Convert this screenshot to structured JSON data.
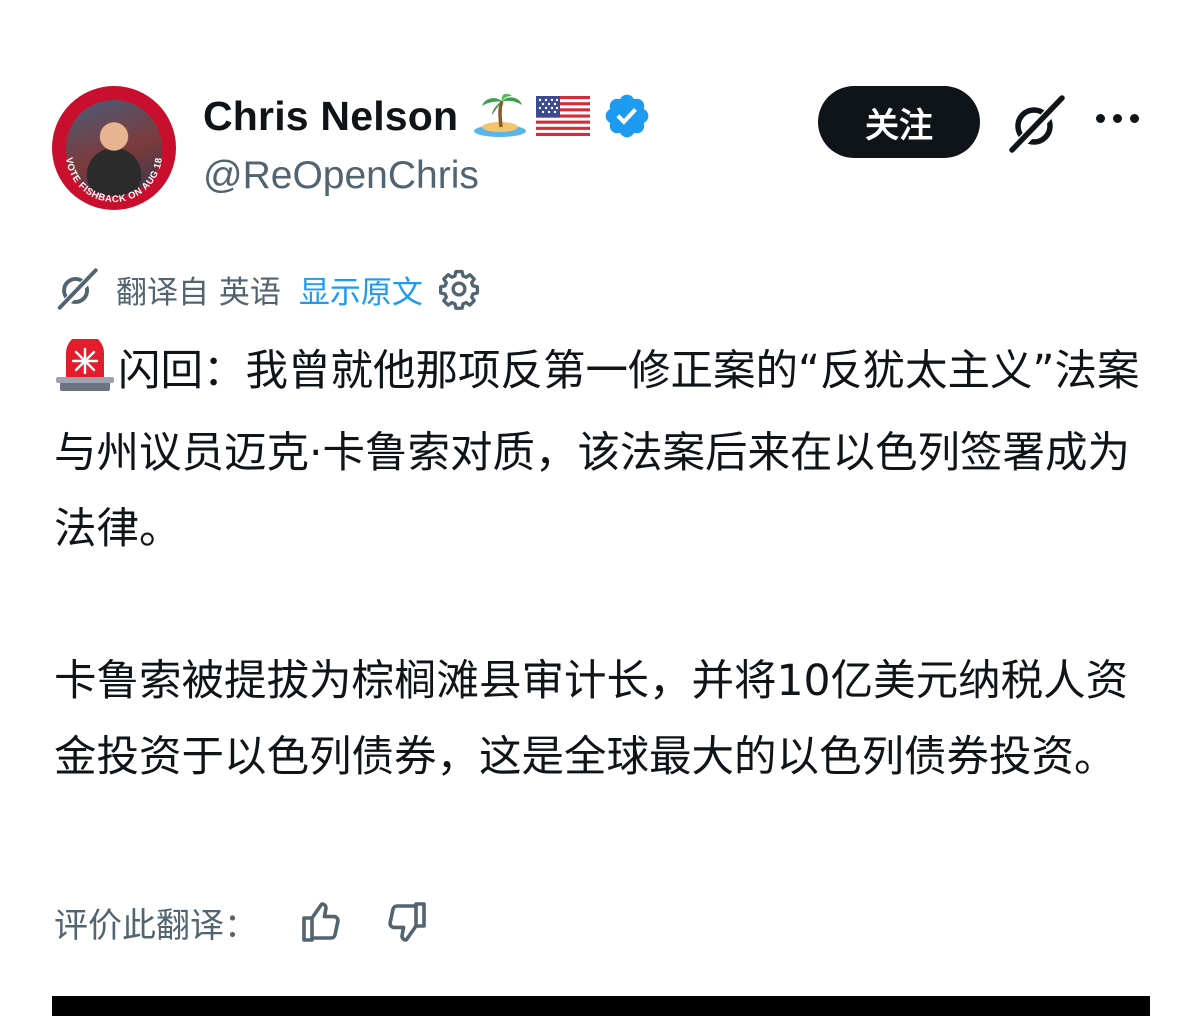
{
  "tweet": {
    "author_name": "Chris Nelson",
    "author_handle": "@ReOpenChris",
    "avatar_caption": "VOTE FISHBACK ON AUG 18",
    "follow_label": "关注",
    "name_emojis": [
      "island-emoji",
      "us-flag-emoji",
      "verified-badge"
    ]
  },
  "translation": {
    "translated_from": "翻译自 英语",
    "show_original": "显示原文"
  },
  "content": {
    "paragraph1": "闪回：我曾就他那项反第一修正案的“反犹太主义”法案与州议员迈克·卡鲁索对质，该法案后来在以色列签署成为法律。",
    "paragraph2": "卡鲁索被提拔为棕榈滩县审计长，并将10亿美元纳税人资金投资于以色列债券，这是全球最大的以色列债券投资。"
  },
  "rating": {
    "label": "评价此翻译："
  },
  "colors": {
    "text": "#0f1419",
    "secondary": "#536471",
    "link": "#1d9bf0",
    "verified": "#1d9bf0",
    "avatar_ring": "#c8102e"
  }
}
